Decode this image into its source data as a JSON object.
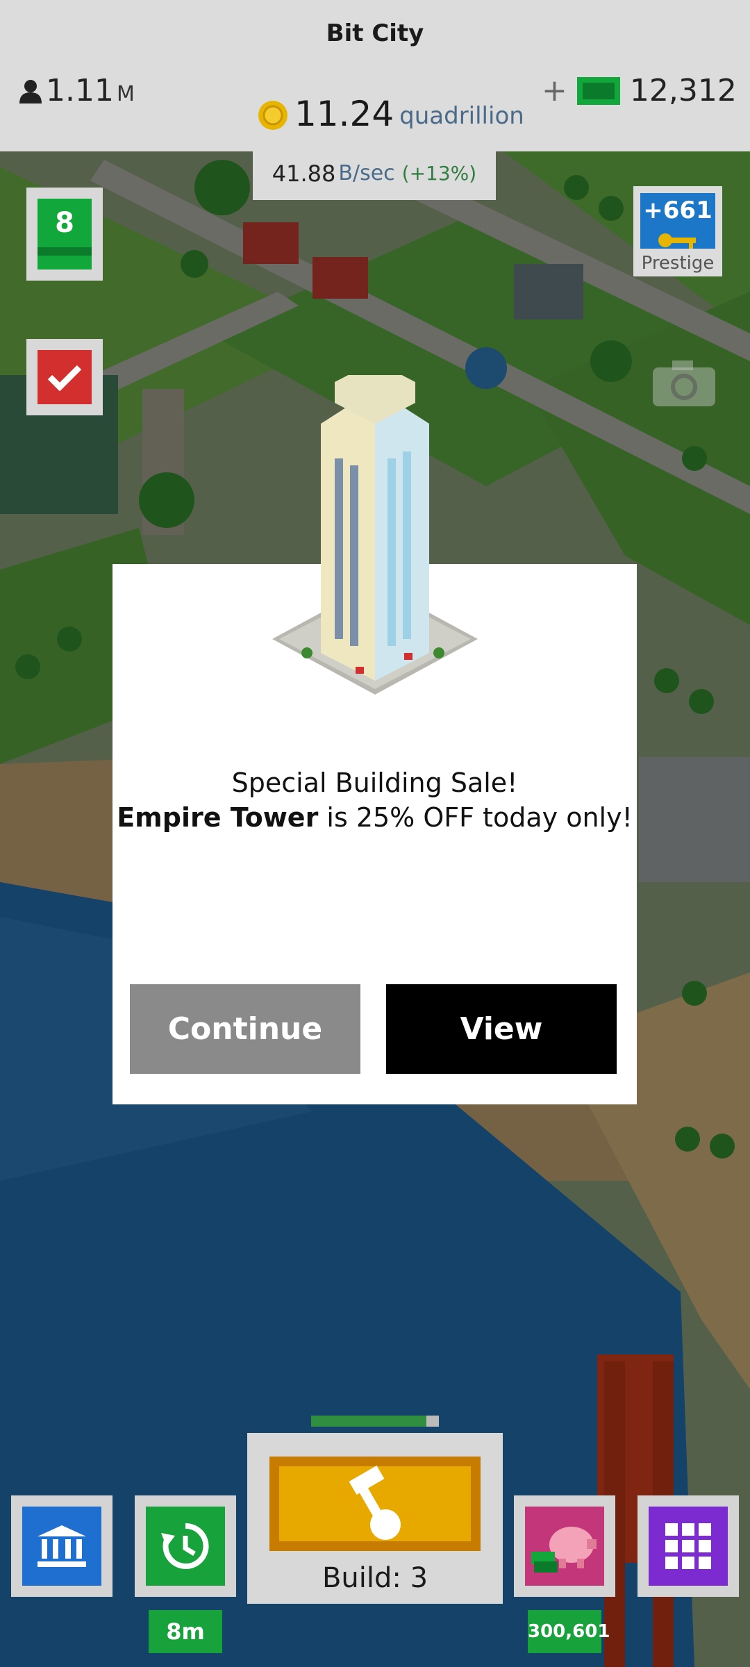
{
  "header": {
    "title": "Bit City",
    "population": {
      "value": "1.11",
      "unit": "M"
    },
    "coins": {
      "value": "11.24",
      "unit": "quadrillion"
    },
    "rate": {
      "value": "41.88",
      "unit": "B/sec",
      "boost": "(+13%)"
    },
    "cash": {
      "plus": "+",
      "value": "12,312"
    }
  },
  "left_panel": {
    "level": "8",
    "prestige": {
      "value": "+661",
      "label": "Prestige"
    }
  },
  "dialog": {
    "line1": "Special Building Sale!",
    "building_name": "Empire Tower",
    "line2_rest": " is 25% OFF today only!",
    "continue_label": "Continue",
    "view_label": "View"
  },
  "bottom_bar": {
    "build_label": "Build: 3",
    "build_progress": 0.9,
    "timer": "8m",
    "piggy_value": "300,601"
  },
  "colors": {
    "cash_green": "#11a73a",
    "coin_gold": "#e7a800",
    "view_button": "#000000",
    "continue_button": "#8a8a8a"
  }
}
